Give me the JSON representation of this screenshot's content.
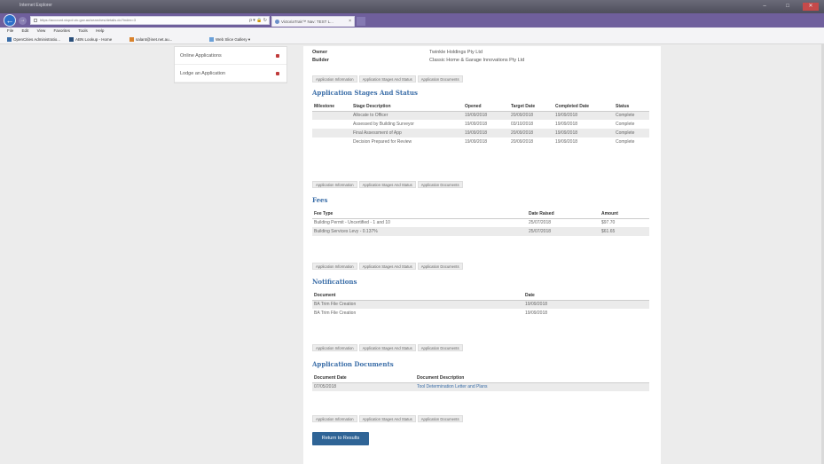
{
  "window": {
    "title_text": "Internet Explorer",
    "buttons": [
      "–",
      "□",
      "✕"
    ]
  },
  "browser": {
    "url": "https://account.vicpol.vic.gov.au/searches/details.do?index=3",
    "url_icons": "ρ ▾ 🔒 ↻",
    "tab_title": "VictoriaTrak™ Nav: TEST L...",
    "tab_close": "×",
    "back": "←",
    "forward": "→"
  },
  "menubar": [
    "File",
    "Edit",
    "View",
    "Favorites",
    "Tools",
    "Help"
  ],
  "favorites": [
    {
      "label": "OpenCities Administratio...",
      "color": "#3b6ea8"
    },
    {
      "label": "ABN Lookup - Home",
      "color": "#2a4f7a"
    },
    {
      "label": "salant@inet.net.au...",
      "color": "#d9822b"
    },
    {
      "label": "Web Slice Gallery ▾",
      "color": "#6aa0d8"
    }
  ],
  "sidemenu": {
    "items": [
      {
        "label": "Online Applications"
      },
      {
        "label": "Lodge an Application"
      }
    ]
  },
  "top_fields": [
    {
      "label": "Owner",
      "value": "Twinkle Holdings Pty Ltd"
    },
    {
      "label": "Builder",
      "value": "Classic Home & Garage Innovations Pty Ltd"
    }
  ],
  "tab_buttons": [
    "Application Information",
    "Application Stages And Status",
    "Application Documents"
  ],
  "stages": {
    "title": "Application Stages And Status",
    "columns": [
      "Milestone",
      "Stage Description",
      "Opened",
      "Target Date",
      "Completed Date",
      "Status"
    ],
    "rows": [
      [
        "",
        "Allocate to Officer",
        "19/09/2018",
        "20/09/2018",
        "19/09/2018",
        "Complete"
      ],
      [
        "",
        "Assessed by Building Surveyor",
        "19/09/2018",
        "03/10/2018",
        "19/09/2018",
        "Complete"
      ],
      [
        "",
        "Final Assessment of App",
        "19/09/2018",
        "20/09/2018",
        "19/09/2018",
        "Complete"
      ],
      [
        "",
        "Decision Prepared for Review",
        "19/09/2018",
        "20/09/2018",
        "19/09/2018",
        "Complete"
      ]
    ]
  },
  "fees": {
    "title": "Fees",
    "columns": [
      "Fee Type",
      "Date Raised",
      "Amount"
    ],
    "rows": [
      [
        "Building Permit - Uncertified - 1 and 10",
        "25/07/2018",
        "$97.70"
      ],
      [
        "Building Services Levy - 0.137%",
        "25/07/2018",
        "$61.65"
      ]
    ]
  },
  "notifications": {
    "title": "Notifications",
    "columns": [
      "Document",
      "Date"
    ],
    "rows": [
      [
        "BA Trim File Creation",
        "19/09/2018"
      ],
      [
        "BA Trim File Creation",
        "19/09/2018"
      ]
    ]
  },
  "documents": {
    "title": "Application Documents",
    "columns": [
      "Document Date",
      "Document Description"
    ],
    "rows": [
      [
        "07/05/2018",
        "Tool Determination Letter and Plans"
      ]
    ]
  },
  "return_button": "Return to Results"
}
